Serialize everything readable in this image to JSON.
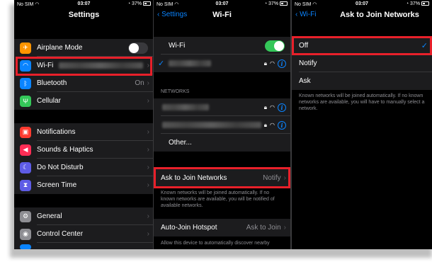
{
  "status": {
    "carrier": "No SIM",
    "time": "03:07",
    "battery": "37%"
  },
  "settings": {
    "title": "Settings",
    "items": [
      {
        "label": "Airplane Mode",
        "icon": "airplane-icon",
        "color": "#ff9500",
        "glyph": "✈"
      },
      {
        "label": "Wi-Fi",
        "icon": "wifi-icon",
        "color": "#0a84ff",
        "glyph": "◠"
      },
      {
        "label": "Bluetooth",
        "icon": "bluetooth-icon",
        "color": "#0a84ff",
        "glyph": "ᛒ",
        "value": "On"
      },
      {
        "label": "Cellular",
        "icon": "antenna-icon",
        "color": "#34c759",
        "glyph": "Ψ"
      },
      {
        "label": "Notifications",
        "icon": "notifications-icon",
        "color": "#ff3b30",
        "glyph": "▣"
      },
      {
        "label": "Sounds & Haptics",
        "icon": "speaker-icon",
        "color": "#ff2d55",
        "glyph": "◀"
      },
      {
        "label": "Do Not Disturb",
        "icon": "moon-icon",
        "color": "#5e5ce6",
        "glyph": "☾"
      },
      {
        "label": "Screen Time",
        "icon": "hourglass-icon",
        "color": "#5e5ce6",
        "glyph": "⧗"
      },
      {
        "label": "General",
        "icon": "gear-icon",
        "color": "#8e8e93",
        "glyph": "⚙"
      },
      {
        "label": "Control Center",
        "icon": "switches-icon",
        "color": "#8e8e93",
        "glyph": "◉"
      }
    ]
  },
  "wifi": {
    "back": "Settings",
    "title": "Wi-Fi",
    "toggle_label": "Wi-Fi",
    "networks_header": "NETWORKS",
    "other": "Other...",
    "ask_label": "Ask to Join Networks",
    "ask_value": "Notify",
    "ask_footer": "Known networks will be joined automatically. If no known networks are available, you will be notified of available networks.",
    "auto_label": "Auto-Join Hotspot",
    "auto_value": "Ask to Join",
    "auto_footer": "Allow this device to automatically discover nearby"
  },
  "ask": {
    "back": "Wi-Fi",
    "title": "Ask to Join Networks",
    "options": [
      "Off",
      "Notify",
      "Ask"
    ],
    "selected": "Off",
    "footer": "Known networks will be joined automatically. If no known networks are available, you will have to manually select a network."
  }
}
